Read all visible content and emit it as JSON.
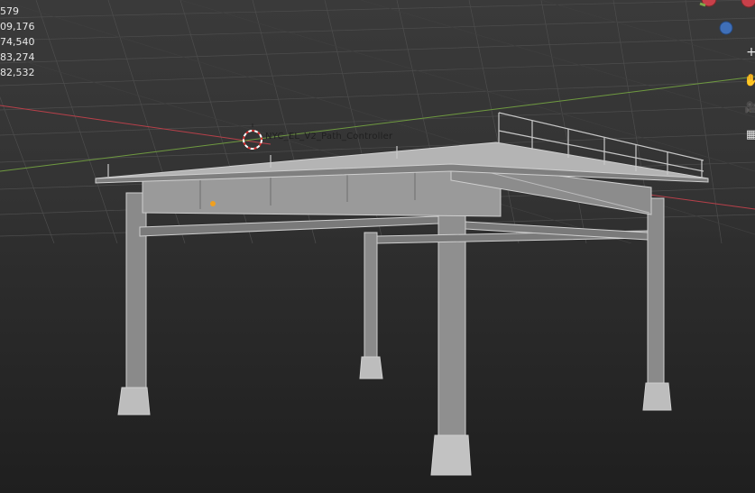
{
  "viewport": {
    "stats": [
      "579",
      "09,176",
      "74,540",
      "83,274",
      "82,532"
    ],
    "object_label": "NYC_EL_V2_Path_Controller"
  },
  "navigation": {
    "zoom_icon_glyph": "+",
    "pan_icon_glyph": "✋",
    "camera_icon_glyph": "🎥",
    "grid_icon_glyph": "▦"
  },
  "colors": {
    "x_axis": "#c8404a",
    "y_axis": "#7ea84a",
    "grid": "#4a4a4a",
    "structure": "#a6a6a6"
  }
}
